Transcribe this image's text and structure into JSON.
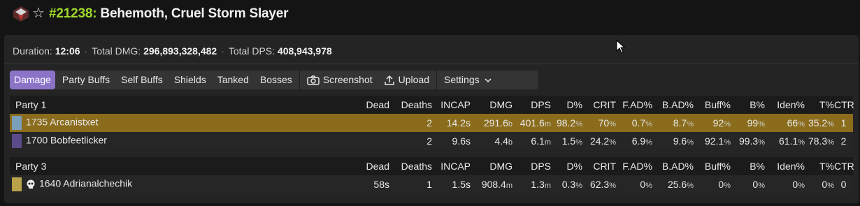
{
  "header": {
    "encounter_number": "#21238:",
    "encounter_name": "Behemoth, Cruel Storm Slayer"
  },
  "summary": {
    "duration_label": "Duration:",
    "duration": "12:06",
    "total_dmg_label": "Total DMG:",
    "total_dmg": "296,893,328,482",
    "total_dps_label": "Total DPS:",
    "total_dps": "408,943,978"
  },
  "tabs": {
    "damage": "Damage",
    "party_buffs": "Party Buffs",
    "self_buffs": "Self Buffs",
    "shields": "Shields",
    "tanked": "Tanked",
    "bosses": "Bosses",
    "screenshot": "Screenshot",
    "upload": "Upload",
    "settings": "Settings"
  },
  "columns": [
    "Dead",
    "Deaths",
    "INCAP",
    "DMG",
    "DPS",
    "D%",
    "CRIT",
    "F.AD%",
    "B.AD%",
    "Buff%",
    "B%",
    "Iden%",
    "T%",
    "CTR"
  ],
  "parties": [
    {
      "name": "Party 1",
      "players": [
        {
          "name": "1735 Arcanistxet",
          "highlight": true,
          "cls_color": "#7a9fb8",
          "cells": [
            {
              "v": ""
            },
            {
              "v": "2"
            },
            {
              "v": "14.2s"
            },
            {
              "v": "291.6",
              "u": "b"
            },
            {
              "v": "401.6",
              "u": "m"
            },
            {
              "v": "98.2",
              "u": "%"
            },
            {
              "v": "70",
              "u": "%"
            },
            {
              "v": "0.7",
              "u": "%"
            },
            {
              "v": "8.7",
              "u": "%"
            },
            {
              "v": "92",
              "u": "%"
            },
            {
              "v": "99",
              "u": "%"
            },
            {
              "v": "66",
              "u": "%"
            },
            {
              "v": "35.2",
              "u": "%"
            },
            {
              "v": "1"
            }
          ]
        },
        {
          "name": "1700 Bobfeetlicker",
          "highlight": false,
          "cls_color": "#5b4a8a",
          "cells": [
            {
              "v": ""
            },
            {
              "v": "2"
            },
            {
              "v": "9.6s"
            },
            {
              "v": "4.4",
              "u": "b"
            },
            {
              "v": "6.1",
              "u": "m"
            },
            {
              "v": "1.5",
              "u": "%"
            },
            {
              "v": "24.2",
              "u": "%"
            },
            {
              "v": "6.9",
              "u": "%"
            },
            {
              "v": "9.6",
              "u": "%"
            },
            {
              "v": "92.1",
              "u": "%"
            },
            {
              "v": "99.3",
              "u": "%"
            },
            {
              "v": "61.1",
              "u": "%"
            },
            {
              "v": "78.3",
              "u": "%"
            },
            {
              "v": "2"
            }
          ]
        }
      ]
    },
    {
      "name": "Party 3",
      "players": [
        {
          "name": "1640 Adrianalchechik",
          "highlight": false,
          "dead": true,
          "cls_color": "#b8a24a",
          "cells": [
            {
              "v": "58s"
            },
            {
              "v": "1"
            },
            {
              "v": "1.5s"
            },
            {
              "v": "908.4",
              "u": "m"
            },
            {
              "v": "1.3",
              "u": "m"
            },
            {
              "v": "0.3",
              "u": "%"
            },
            {
              "v": "62.3",
              "u": "%"
            },
            {
              "v": "0",
              "u": "%"
            },
            {
              "v": "25.6",
              "u": "%"
            },
            {
              "v": "0",
              "u": "%"
            },
            {
              "v": "0",
              "u": "%"
            },
            {
              "v": "0",
              "u": "%"
            },
            {
              "v": "0",
              "u": "%"
            },
            {
              "v": "0"
            }
          ]
        }
      ]
    }
  ]
}
